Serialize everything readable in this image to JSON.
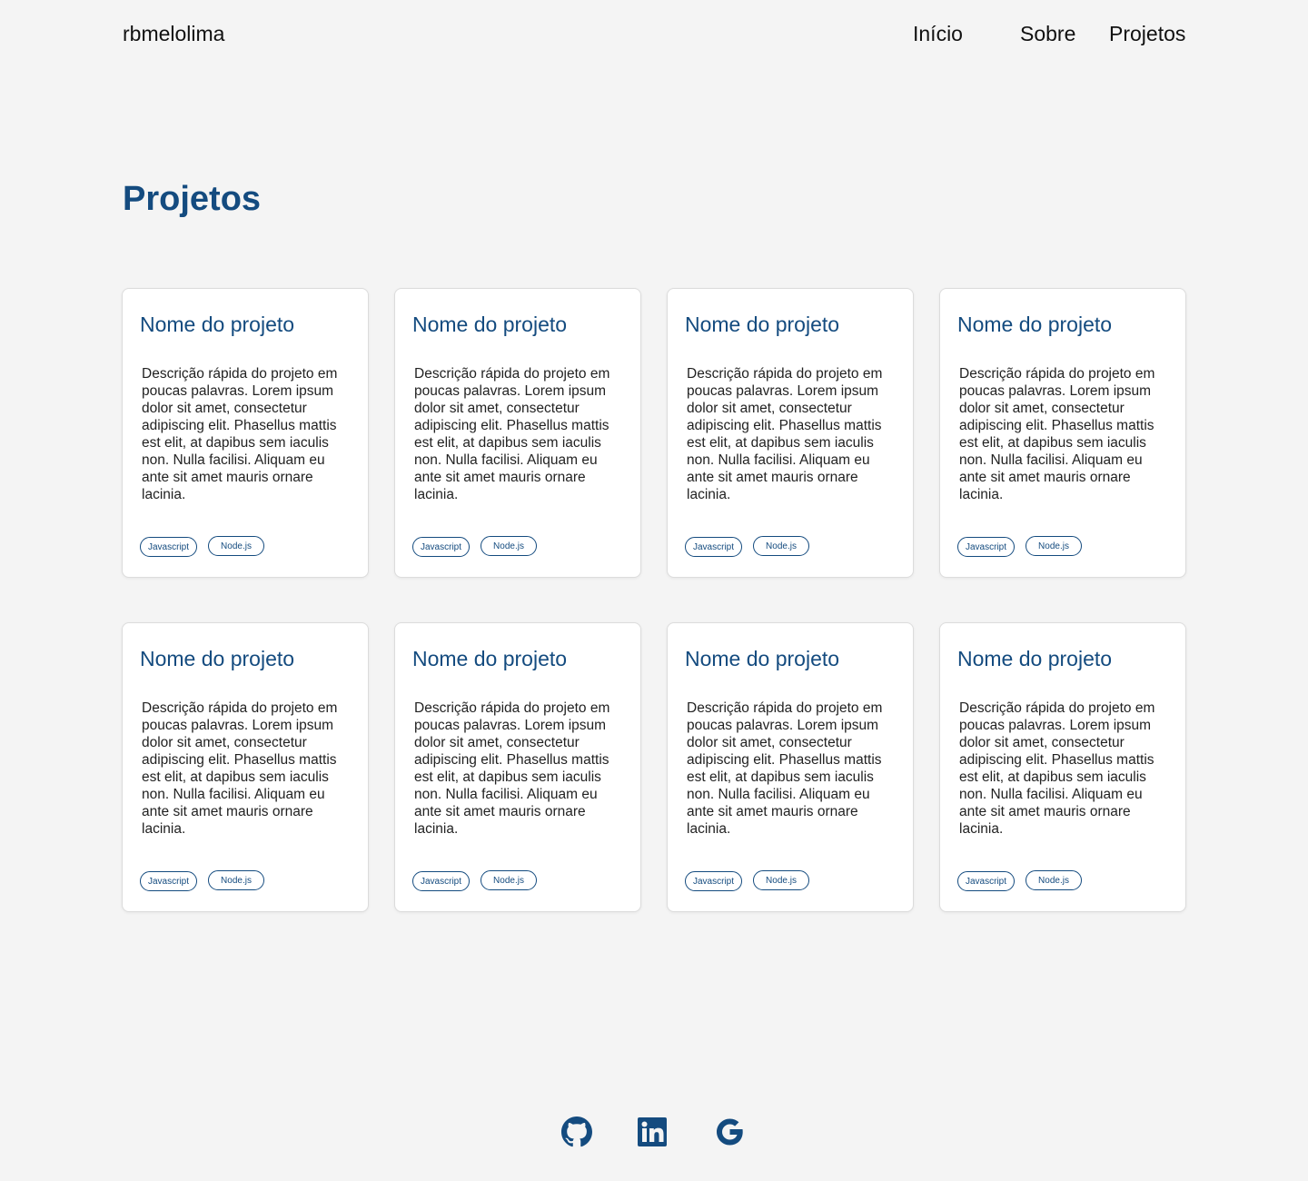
{
  "header": {
    "brand": "rbmelolima",
    "nav": [
      {
        "label": "Início"
      },
      {
        "label": "Sobre"
      },
      {
        "label": "Projetos"
      }
    ]
  },
  "main": {
    "title": "Projetos",
    "cards": [
      {
        "title": "Nome do projeto",
        "description": "Descrição rápida do projeto em poucas palavras. Lorem ipsum dolor sit amet, consectetur adipiscing elit. Phasellus mattis est elit, at dapibus sem iaculis non. Nulla facilisi. Aliquam eu ante sit amet mauris ornare lacinia.",
        "tags": [
          "Javascript",
          "Node.js"
        ]
      },
      {
        "title": "Nome do projeto",
        "description": "Descrição rápida do projeto em poucas palavras. Lorem ipsum dolor sit amet, consectetur adipiscing elit. Phasellus mattis est elit, at dapibus sem iaculis non. Nulla facilisi. Aliquam eu ante sit amet mauris ornare lacinia.",
        "tags": [
          "Javascript",
          "Node.js"
        ]
      },
      {
        "title": "Nome do projeto",
        "description": "Descrição rápida do projeto em poucas palavras. Lorem ipsum dolor sit amet, consectetur adipiscing elit. Phasellus mattis est elit, at dapibus sem iaculis non. Nulla facilisi. Aliquam eu ante sit amet mauris ornare lacinia.",
        "tags": [
          "Javascript",
          "Node.js"
        ]
      },
      {
        "title": "Nome do projeto",
        "description": "Descrição rápida do projeto em poucas palavras. Lorem ipsum dolor sit amet, consectetur adipiscing elit. Phasellus mattis est elit, at dapibus sem iaculis non. Nulla facilisi. Aliquam eu ante sit amet mauris ornare lacinia.",
        "tags": [
          "Javascript",
          "Node.js"
        ]
      },
      {
        "title": "Nome do projeto",
        "description": "Descrição rápida do projeto em poucas palavras. Lorem ipsum dolor sit amet, consectetur adipiscing elit. Phasellus mattis est elit, at dapibus sem iaculis non. Nulla facilisi. Aliquam eu ante sit amet mauris ornare lacinia.",
        "tags": [
          "Javascript",
          "Node.js"
        ]
      },
      {
        "title": "Nome do projeto",
        "description": "Descrição rápida do projeto em poucas palavras. Lorem ipsum dolor sit amet, consectetur adipiscing elit. Phasellus mattis est elit, at dapibus sem iaculis non. Nulla facilisi. Aliquam eu ante sit amet mauris ornare lacinia.",
        "tags": [
          "Javascript",
          "Node.js"
        ]
      },
      {
        "title": "Nome do projeto",
        "description": "Descrição rápida do projeto em poucas palavras. Lorem ipsum dolor sit amet, consectetur adipiscing elit. Phasellus mattis est elit, at dapibus sem iaculis non. Nulla facilisi. Aliquam eu ante sit amet mauris ornare lacinia.",
        "tags": [
          "Javascript",
          "Node.js"
        ]
      },
      {
        "title": "Nome do projeto",
        "description": "Descrição rápida do projeto em poucas palavras. Lorem ipsum dolor sit amet, consectetur adipiscing elit. Phasellus mattis est elit, at dapibus sem iaculis non. Nulla facilisi. Aliquam eu ante sit amet mauris ornare lacinia.",
        "tags": [
          "Javascript",
          "Node.js"
        ]
      }
    ]
  },
  "footer": {
    "icons": [
      "github-icon",
      "linkedin-icon",
      "google-icon"
    ]
  },
  "colors": {
    "accent": "#144b7f",
    "background": "#f4f4f4",
    "card": "#ffffff"
  }
}
